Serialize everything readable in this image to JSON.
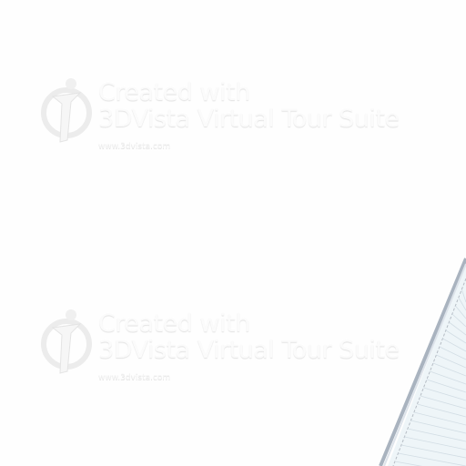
{
  "watermarks": [
    {
      "line1": "Created with",
      "line2": "3DVista Virtual Tour Suite",
      "url": "www.3dvista.com"
    },
    {
      "line1": "Created with",
      "line2": "3DVista Virtual Tour Suite",
      "url": "www.3dvista.com"
    }
  ],
  "colors": {
    "background": "#fefefe",
    "paper": "#eef5f8",
    "binding": "#a9b3bf"
  }
}
